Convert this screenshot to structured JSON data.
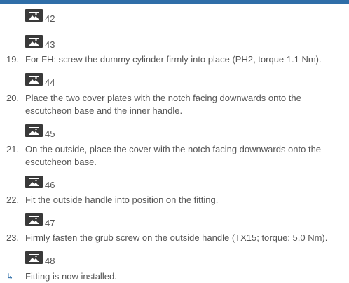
{
  "figures": {
    "f42": "42",
    "f43": "43",
    "f44": "44",
    "f45": "45",
    "f46": "46",
    "f47": "47",
    "f48": "48"
  },
  "steps": [
    {
      "num": "19.",
      "text": "For FH: screw the dummy cylinder firmly into place (PH2, torque 1.1 Nm)."
    },
    {
      "num": "20.",
      "text": "Place the two cover plates with the notch facing downwards onto the escutcheon base and the inner handle."
    },
    {
      "num": "21.",
      "text": "On the outside, place the cover with the notch facing downwards onto the escutcheon base."
    },
    {
      "num": "22.",
      "text": "Fit the outside handle into position on the fitting."
    },
    {
      "num": "23.",
      "text": "Firmly fasten the grub screw on the outside handle (TX15; torque: 5.0 Nm)."
    }
  ],
  "result": {
    "arrow": "↳",
    "text": "Fitting is now installed."
  },
  "colors": {
    "accent": "#2f6ea8",
    "text": "#555555",
    "icon_bg": "#3a3a3a"
  },
  "icons": {
    "figure": "image-placeholder-icon"
  }
}
